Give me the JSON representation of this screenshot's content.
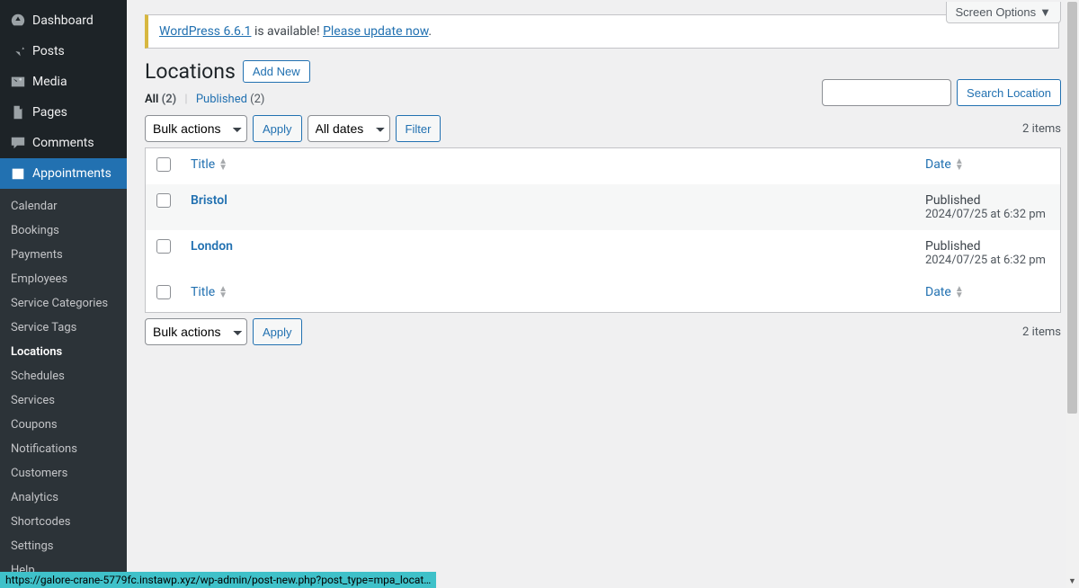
{
  "screen_options_label": "Screen Options",
  "notice": {
    "link1_text": "WordPress 6.6.1",
    "mid_text": " is available! ",
    "link2_text": "Please update now",
    "end_text": "."
  },
  "heading": "Locations",
  "add_new_label": "Add New",
  "filters": {
    "all_label": "All",
    "all_count": "(2)",
    "published_label": "Published",
    "published_count": "(2)"
  },
  "bulk": {
    "select_label": "Bulk actions",
    "apply_label": "Apply"
  },
  "date_filter": {
    "select_label": "All dates",
    "filter_label": "Filter"
  },
  "search": {
    "button_label": "Search Location"
  },
  "count_text": "2 items",
  "columns": {
    "title": "Title",
    "date": "Date"
  },
  "rows": [
    {
      "title": "Bristol",
      "status": "Published",
      "datetime": "2024/07/25 at 6:32 pm"
    },
    {
      "title": "London",
      "status": "Published",
      "datetime": "2024/07/25 at 6:32 pm"
    }
  ],
  "sidebar": {
    "items": [
      {
        "label": "Dashboard",
        "icon": "speedometer-icon"
      },
      {
        "label": "Posts",
        "icon": "pin-icon"
      },
      {
        "label": "Media",
        "icon": "media-icon"
      },
      {
        "label": "Pages",
        "icon": "page-icon"
      },
      {
        "label": "Comments",
        "icon": "comment-icon"
      },
      {
        "label": "Appointments",
        "icon": "calendar-icon",
        "active": true
      }
    ],
    "submenu": [
      "Calendar",
      "Bookings",
      "Payments",
      "Employees",
      "Service Categories",
      "Service Tags",
      "Locations",
      "Schedules",
      "Services",
      "Coupons",
      "Notifications",
      "Customers",
      "Analytics",
      "Shortcodes",
      "Settings",
      "Help"
    ],
    "submenu_current": "Locations"
  },
  "status_bar": "https://galore-crane-5779fc.instawp.xyz/wp-admin/post-new.php?post_type=mpa_locat…"
}
